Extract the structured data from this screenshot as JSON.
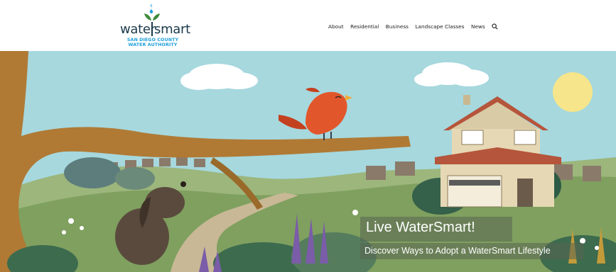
{
  "logo": {
    "word_left": "water",
    "word_right": "smart",
    "subtitle_line1": "SAN DIEGO COUNTY",
    "subtitle_line2": "WATER AUTHORITY"
  },
  "nav": {
    "items": [
      {
        "label": "About"
      },
      {
        "label": "Residential"
      },
      {
        "label": "Business"
      },
      {
        "label": "Landscape Classes"
      },
      {
        "label": "News"
      }
    ],
    "search_icon": "search-icon"
  },
  "hero": {
    "title": "Live WaterSmart!",
    "subtitle": "Discover Ways to Adopt a WaterSmart Lifestyle"
  },
  "colors": {
    "sky": "#a6d8de",
    "brand_navy": "#1b3a4b",
    "brand_blue": "#1e9fdb",
    "leaf_green": "#3f8a3a",
    "bird_orange": "#e2562b"
  }
}
